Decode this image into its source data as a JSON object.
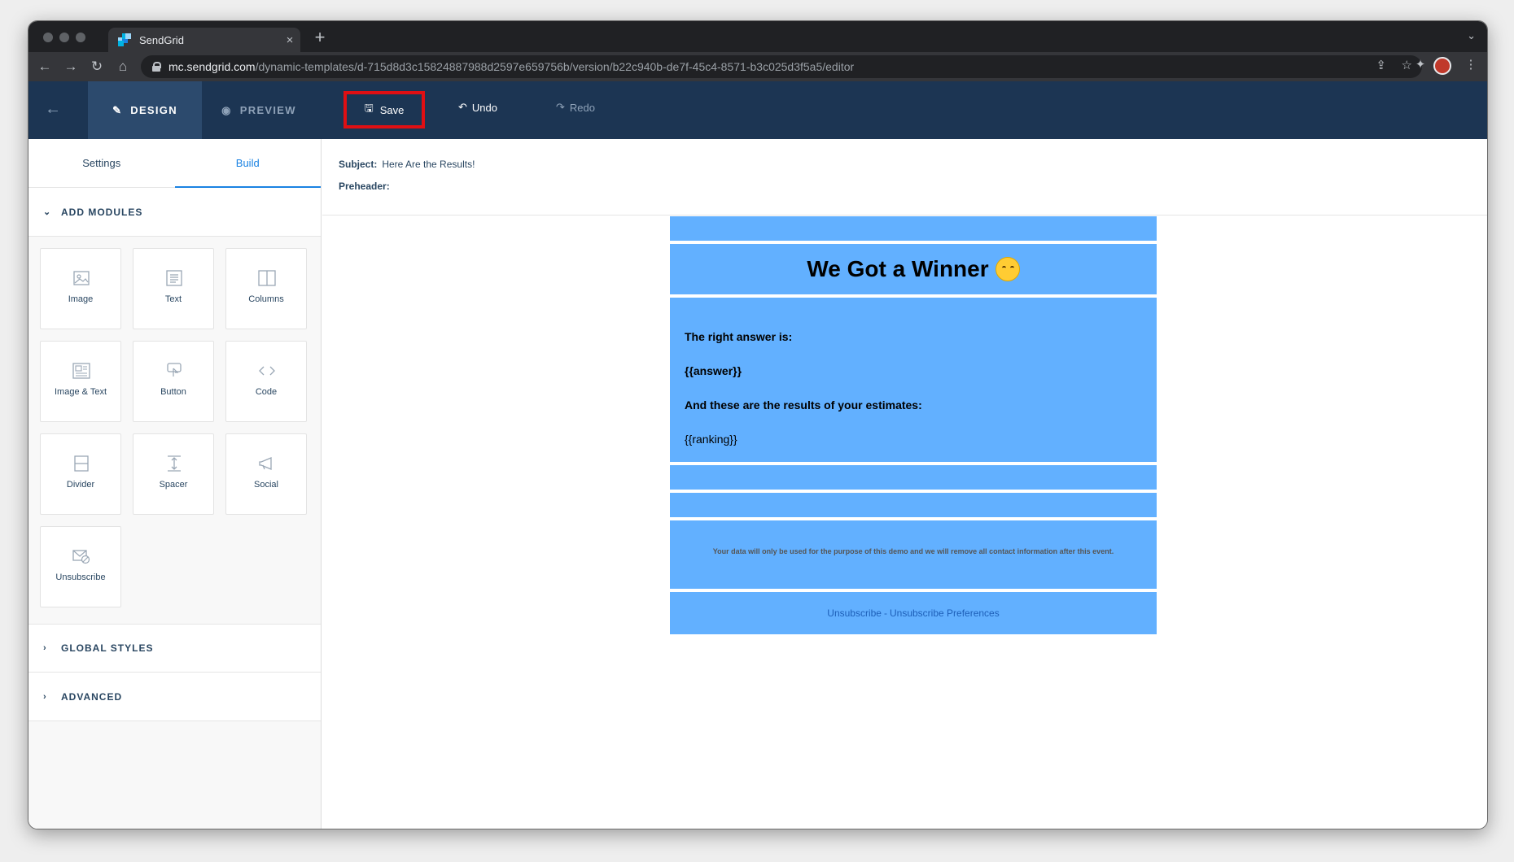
{
  "browser": {
    "tab_title": "SendGrid",
    "tab_close": "×",
    "new_tab": "+",
    "url_host": "mc.sendgrid.com",
    "url_path": "/dynamic-templates/d-715d8d3c15824887988d2597e659756b/version/b22c940b-de7f-45c4-8571-b3c025d3f5a5/editor"
  },
  "header": {
    "design_label": "DESIGN",
    "preview_label": "PREVIEW",
    "save_label": "Save",
    "undo_label": "Undo",
    "redo_label": "Redo",
    "save_highlight_color": "#e00f13"
  },
  "sidebar": {
    "tabs": [
      {
        "label": "Settings",
        "active": false
      },
      {
        "label": "Build",
        "active": true
      }
    ],
    "add_modules_label": "ADD MODULES",
    "modules": [
      {
        "label": "Image",
        "icon": "image-icon"
      },
      {
        "label": "Text",
        "icon": "text-icon"
      },
      {
        "label": "Columns",
        "icon": "columns-icon"
      },
      {
        "label": "Image & Text",
        "icon": "image-text-icon"
      },
      {
        "label": "Button",
        "icon": "button-icon"
      },
      {
        "label": "Code",
        "icon": "code-icon"
      },
      {
        "label": "Divider",
        "icon": "divider-icon"
      },
      {
        "label": "Spacer",
        "icon": "spacer-icon"
      },
      {
        "label": "Social",
        "icon": "social-icon"
      },
      {
        "label": "Unsubscribe",
        "icon": "unsubscribe-icon"
      }
    ],
    "global_styles_label": "GLOBAL STYLES",
    "advanced_label": "ADVANCED"
  },
  "meta": {
    "subject_label": "Subject:",
    "subject_value": "Here Are the Results!",
    "preheader_label": "Preheader:",
    "preheader_value": ""
  },
  "email": {
    "bg_color": "#62b0ff",
    "title": "We Got a Winner",
    "title_emoji": "partying-face-emoji",
    "line1": "The right answer is:",
    "line2": "{{answer}}",
    "line3": "And these are the results of your estimates:",
    "line4": "{{ranking}}",
    "footer_text": "Your data will only be used for the purpose of this demo and we will remove all contact information after this event.",
    "unsubscribe_label": "Unsubscribe",
    "separator": "-",
    "preferences_label": "Unsubscribe Preferences"
  }
}
